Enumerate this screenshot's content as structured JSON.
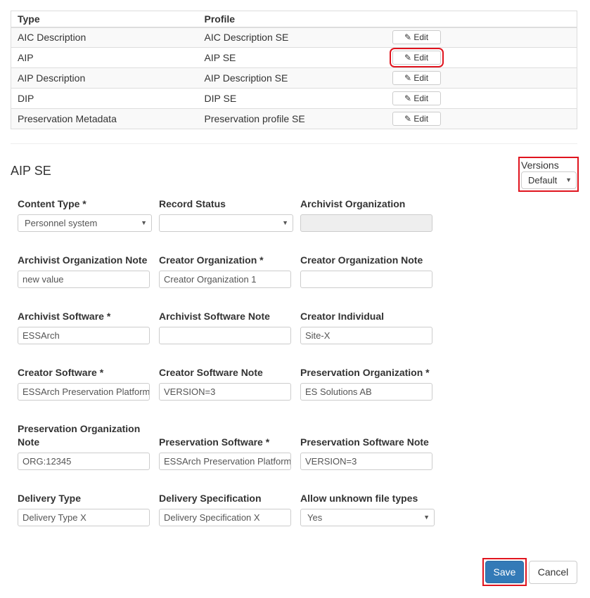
{
  "table": {
    "headers": [
      "Type",
      "Profile"
    ],
    "edit_label": "Edit",
    "rows": [
      {
        "type": "AIC Description",
        "profile": "AIC Description SE"
      },
      {
        "type": "AIP",
        "profile": "AIP SE"
      },
      {
        "type": "AIP Description",
        "profile": "AIP Description SE"
      },
      {
        "type": "DIP",
        "profile": "DIP SE"
      },
      {
        "type": "Preservation Metadata",
        "profile": "Preservation profile SE"
      }
    ]
  },
  "form": {
    "title": "AIP SE",
    "versions_label": "Versions",
    "versions_value": "Default",
    "fields": [
      {
        "label": "Content Type *",
        "value": "Personnel system",
        "kind": "select"
      },
      {
        "label": "Record Status",
        "value": "",
        "kind": "select"
      },
      {
        "label": "Archivist Organization",
        "value": "",
        "kind": "disabled"
      },
      {
        "label": "Archivist Organization Note",
        "value": "new value",
        "kind": "text"
      },
      {
        "label": "Creator Organization *",
        "value": "Creator Organization 1",
        "kind": "text"
      },
      {
        "label": "Creator Organization Note",
        "value": "",
        "kind": "text"
      },
      {
        "label": "Archivist Software *",
        "value": "ESSArch",
        "kind": "text"
      },
      {
        "label": "Archivist Software Note",
        "value": "",
        "kind": "text"
      },
      {
        "label": "Creator Individual",
        "value": "Site-X",
        "kind": "text"
      },
      {
        "label": "Creator Software *",
        "value": "ESSArch Preservation Platform",
        "kind": "text"
      },
      {
        "label": "Creator Software Note",
        "value": "VERSION=3",
        "kind": "text"
      },
      {
        "label": "Preservation Organization *",
        "value": "ES Solutions AB",
        "kind": "text"
      },
      {
        "label": "Preservation Organization Note",
        "value": "ORG:12345",
        "kind": "text"
      },
      {
        "label": "Preservation Software *",
        "value": "ESSArch Preservation Platform",
        "kind": "text"
      },
      {
        "label": "Preservation Software Note",
        "value": "VERSION=3",
        "kind": "text"
      },
      {
        "label": "Delivery Type",
        "value": "Delivery Type X",
        "kind": "text"
      },
      {
        "label": "Delivery Specification",
        "value": "Delivery Specification X",
        "kind": "text"
      },
      {
        "label": "Allow unknown file types",
        "value": "Yes",
        "kind": "select"
      }
    ]
  },
  "buttons": {
    "save": "Save",
    "cancel": "Cancel"
  }
}
